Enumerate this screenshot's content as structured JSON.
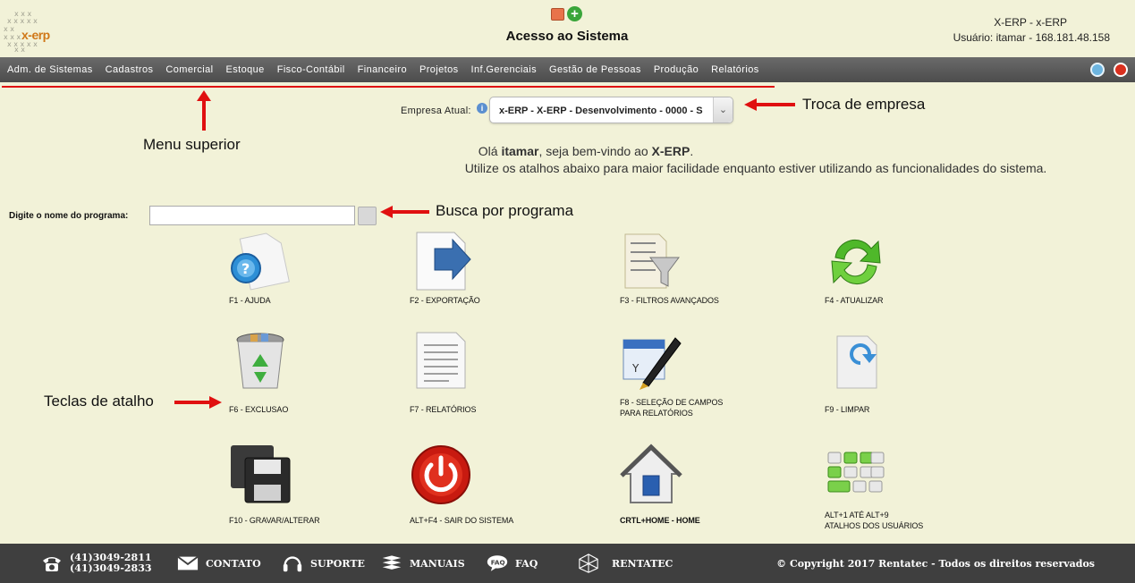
{
  "header": {
    "logo_text": "x-erp",
    "title": "Acesso ao Sistema",
    "user_line1": "X-ERP - x-ERP",
    "user_line2": "Usuário: itamar - 168.181.48.158"
  },
  "menu": {
    "items": [
      "Adm. de Sistemas",
      "Cadastros",
      "Comercial",
      "Estoque",
      "Fisco-Contábil",
      "Financeiro",
      "Projetos",
      "Inf.Gerenciais",
      "Gestão de Pessoas",
      "Produção",
      "Relatórios"
    ]
  },
  "annotations": {
    "menu_superior": "Menu superior",
    "troca_empresa": "Troca de empresa",
    "busca_programa": "Busca por programa",
    "teclas_atalho": "Teclas de atalho"
  },
  "company": {
    "label": "Empresa Atual:",
    "selected": "x-ERP - X-ERP - Desenvolvimento - 0000 - S"
  },
  "welcome": {
    "prefix": "Olá ",
    "user": "itamar",
    "middle": ", seja bem-vindo ao ",
    "system": "X-ERP",
    "suffix": ".",
    "line2": "Utilize os atalhos abaixo para maior facilidade enquanto estiver utilizando as funcionalidades do sistema."
  },
  "search": {
    "label": "Digite o nome do programa:",
    "value": ""
  },
  "shortcuts": [
    {
      "line1": "F1 - AJUDA",
      "line2": "",
      "icon": "help-icon"
    },
    {
      "line1": "F2 - EXPORTAÇÃO",
      "line2": "",
      "icon": "export-icon"
    },
    {
      "line1": "F3 - FILTROS AVANÇADOS",
      "line2": "",
      "icon": "filter-icon"
    },
    {
      "line1": "F4 - ATUALIZAR",
      "line2": "",
      "icon": "refresh-icon"
    },
    {
      "line1": "F6 - EXCLUSAO",
      "line2": "",
      "icon": "recycle-bin-icon"
    },
    {
      "line1": "F7 - RELATÓRIOS",
      "line2": "",
      "icon": "report-icon"
    },
    {
      "line1": "F8 - SELEÇÃO DE CAMPOS",
      "line2": "PARA RELATÓRIOS",
      "icon": "field-selection-icon"
    },
    {
      "line1": "F9 - LIMPAR",
      "line2": "",
      "icon": "clear-icon"
    },
    {
      "line1": "F10 - GRAVAR/ALTERAR",
      "line2": "",
      "icon": "save-icon"
    },
    {
      "line1": "ALT+F4 - SAIR DO SISTEMA",
      "line2": "",
      "icon": "power-icon"
    },
    {
      "line1": "CRTL+HOME - HOME",
      "line2": "",
      "icon": "home-icon"
    },
    {
      "line1": "ALT+1 ATÉ ALT+9",
      "line2": "ATALHOS DOS USUÁRIOS",
      "icon": "user-shortcuts-icon"
    }
  ],
  "footer": {
    "phone1": "(41)3049-2811",
    "phone2": "(41)3049-2833",
    "contato": "CONTATO",
    "suporte": "SUPORTE",
    "manuais": "MANUAIS",
    "faq": "FAQ",
    "faq_icon_text": "FAQ",
    "rentatec": "RENTATEC",
    "copyright": "© Copyright 2017 Rentatec - Todos os direitos reservados"
  },
  "colors": {
    "background": "#f2f2d8",
    "menubar": "#555555",
    "annotation_red": "#e01010",
    "footer": "#3f3f3f",
    "logo_orange": "#d07818"
  }
}
